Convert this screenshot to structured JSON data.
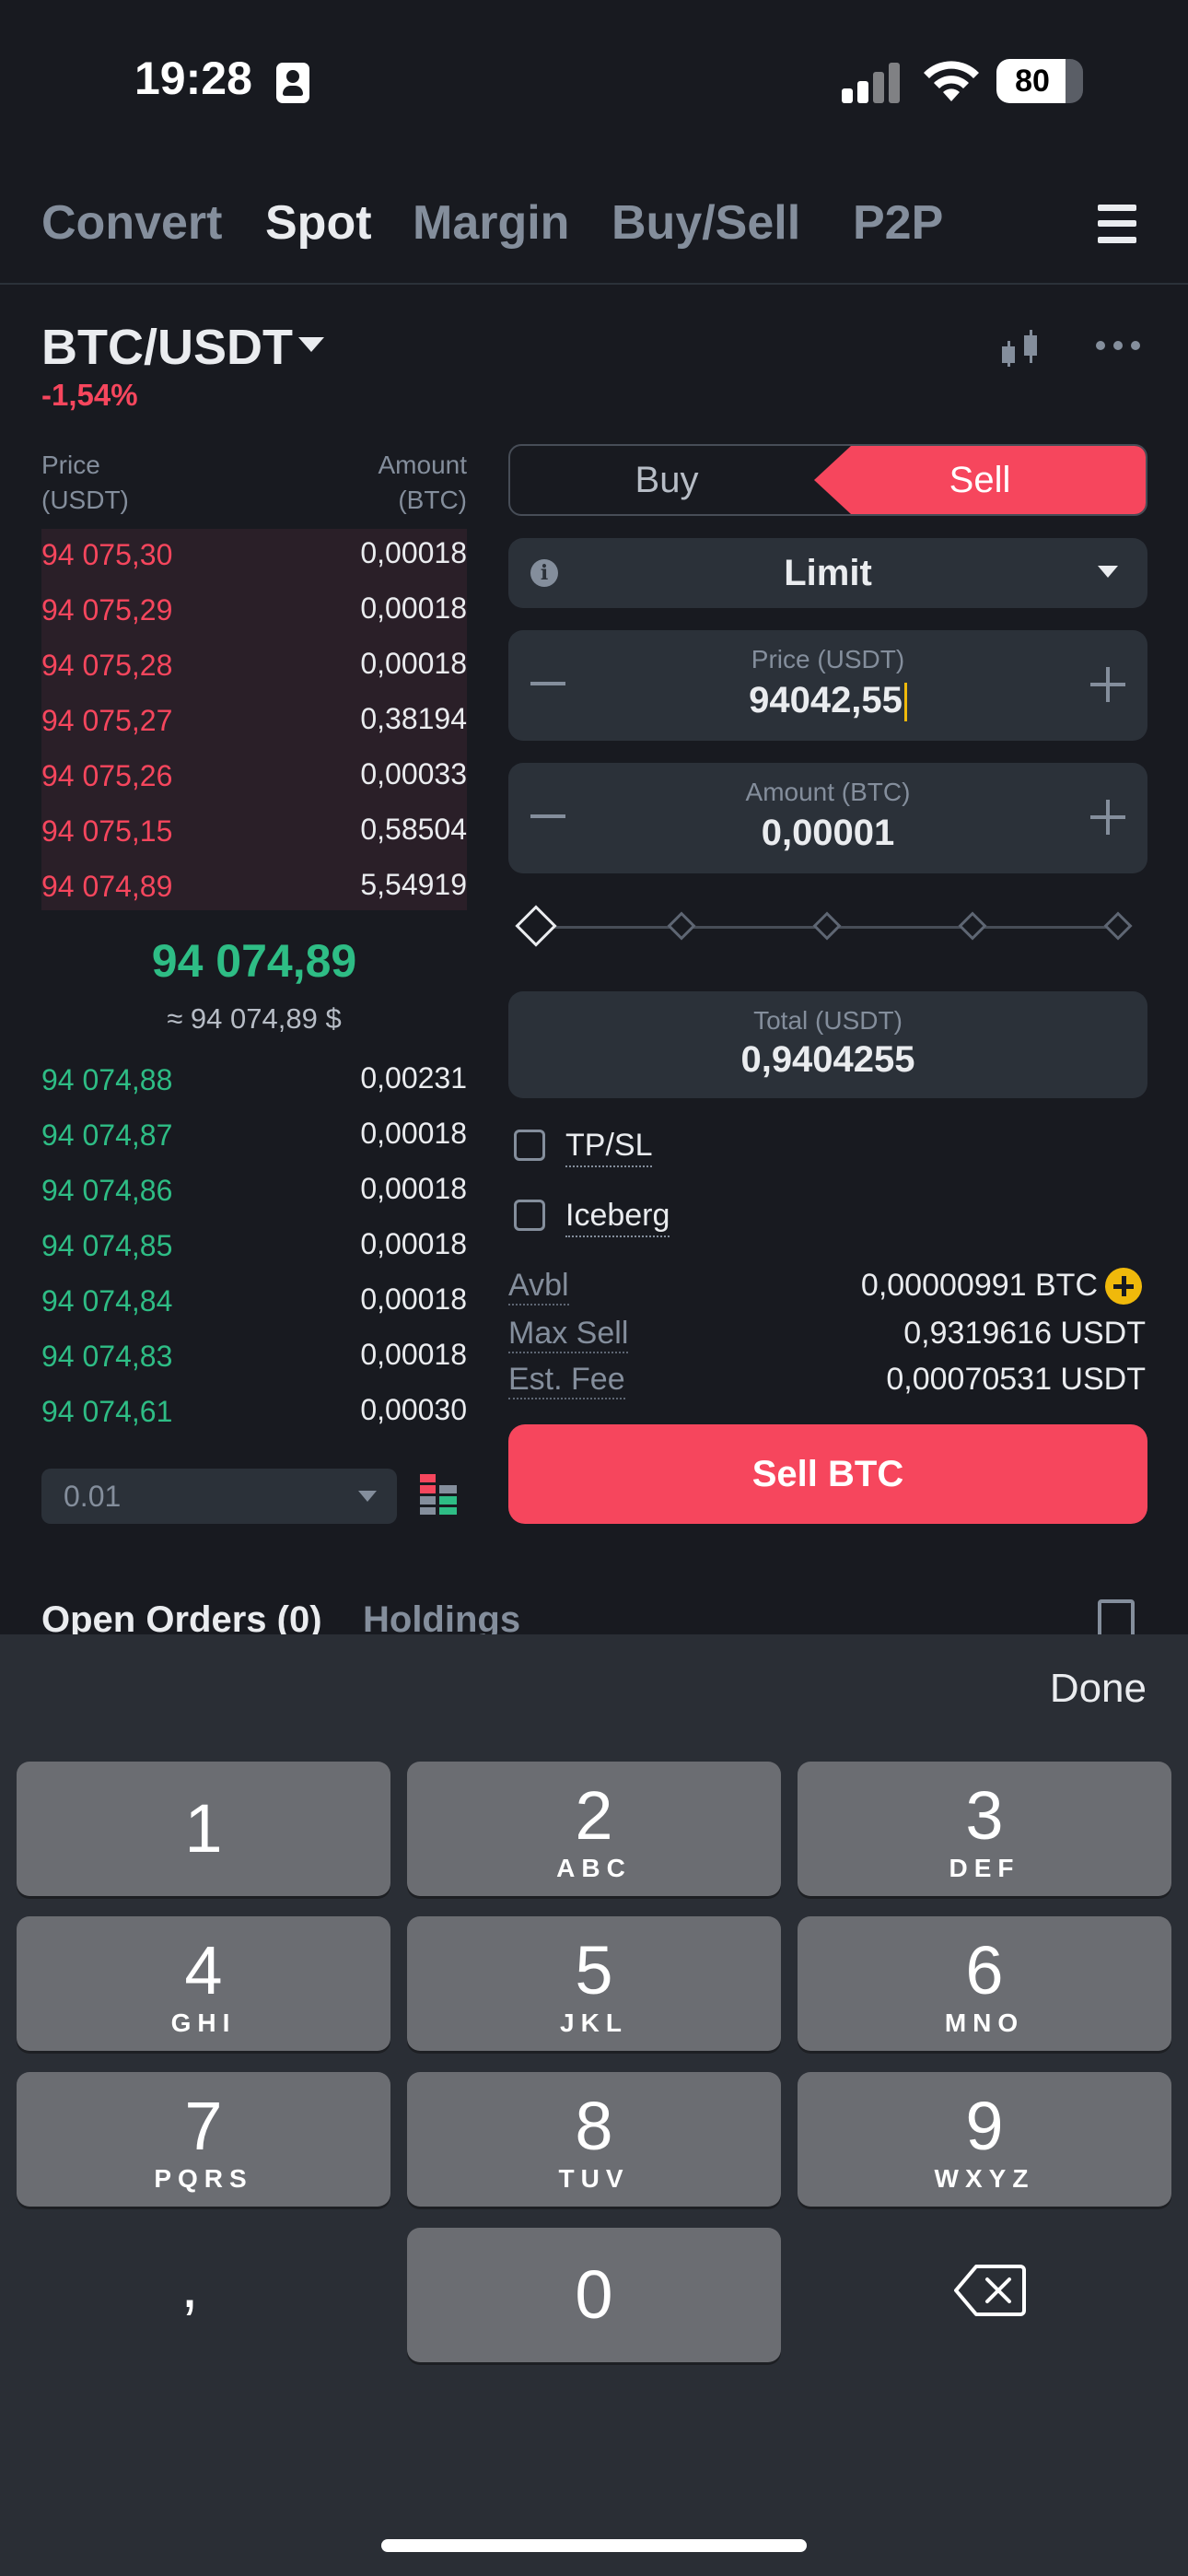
{
  "status_bar": {
    "time": "19:28",
    "battery": "80"
  },
  "nav": {
    "tabs": [
      "Convert",
      "Spot",
      "Margin",
      "Buy/Sell",
      "P2P"
    ],
    "active": "Spot"
  },
  "pair": {
    "name": "BTC/USDT",
    "change": "-1,54%"
  },
  "order_book": {
    "price_header": "Price\n(USDT)",
    "price_header_line1": "Price",
    "price_header_line2": "(USDT)",
    "amount_header_line1": "Amount",
    "amount_header_line2": "(BTC)",
    "asks": [
      {
        "price": "94 075,30",
        "amount": "0,00018"
      },
      {
        "price": "94 075,29",
        "amount": "0,00018"
      },
      {
        "price": "94 075,28",
        "amount": "0,00018"
      },
      {
        "price": "94 075,27",
        "amount": "0,38194"
      },
      {
        "price": "94 075,26",
        "amount": "0,00033"
      },
      {
        "price": "94 075,15",
        "amount": "0,58504"
      },
      {
        "price": "94 074,89",
        "amount": "5,54919"
      }
    ],
    "mid_price": "94 074,89",
    "mid_usd": "≈ 94 074,89 $",
    "bids": [
      {
        "price": "94 074,88",
        "amount": "0,00231"
      },
      {
        "price": "94 074,87",
        "amount": "0,00018"
      },
      {
        "price": "94 074,86",
        "amount": "0,00018"
      },
      {
        "price": "94 074,85",
        "amount": "0,00018"
      },
      {
        "price": "94 074,84",
        "amount": "0,00018"
      },
      {
        "price": "94 074,83",
        "amount": "0,00018"
      },
      {
        "price": "94 074,61",
        "amount": "0,00030"
      }
    ],
    "precision": "0.01"
  },
  "order_form": {
    "buy_label": "Buy",
    "sell_label": "Sell",
    "order_type": "Limit",
    "price_label": "Price (USDT)",
    "price_value": "94042,55",
    "amount_label": "Amount (BTC)",
    "amount_value": "0,00001",
    "slider_percent": 0,
    "total_label": "Total (USDT)",
    "total_value": "0,9404255",
    "tpsl_label": "TP/SL",
    "iceberg_label": "Iceberg",
    "avbl_label": "Avbl",
    "avbl_value": "0,00000991 BTC",
    "max_sell_label": "Max Sell",
    "max_sell_value": "0,9319616 USDT",
    "fee_label": "Est. Fee",
    "fee_value": "0,00070531 USDT",
    "submit_label": "Sell BTC"
  },
  "bottom_tabs": {
    "open_orders": "Open Orders (0)",
    "holdings": "Holdings"
  },
  "keyboard": {
    "done": "Done",
    "keys": [
      {
        "digit": "1",
        "letters": ""
      },
      {
        "digit": "2",
        "letters": "ABC"
      },
      {
        "digit": "3",
        "letters": "DEF"
      },
      {
        "digit": "4",
        "letters": "GHI"
      },
      {
        "digit": "5",
        "letters": "JKL"
      },
      {
        "digit": "6",
        "letters": "MNO"
      },
      {
        "digit": "7",
        "letters": "PQRS"
      },
      {
        "digit": "8",
        "letters": "TUV"
      },
      {
        "digit": "9",
        "letters": "WXYZ"
      }
    ],
    "comma": ",",
    "zero": "0"
  },
  "colors": {
    "sell": "#f6465d",
    "buy": "#2ebd85",
    "accent": "#f0b90b",
    "background": "#181a20"
  }
}
